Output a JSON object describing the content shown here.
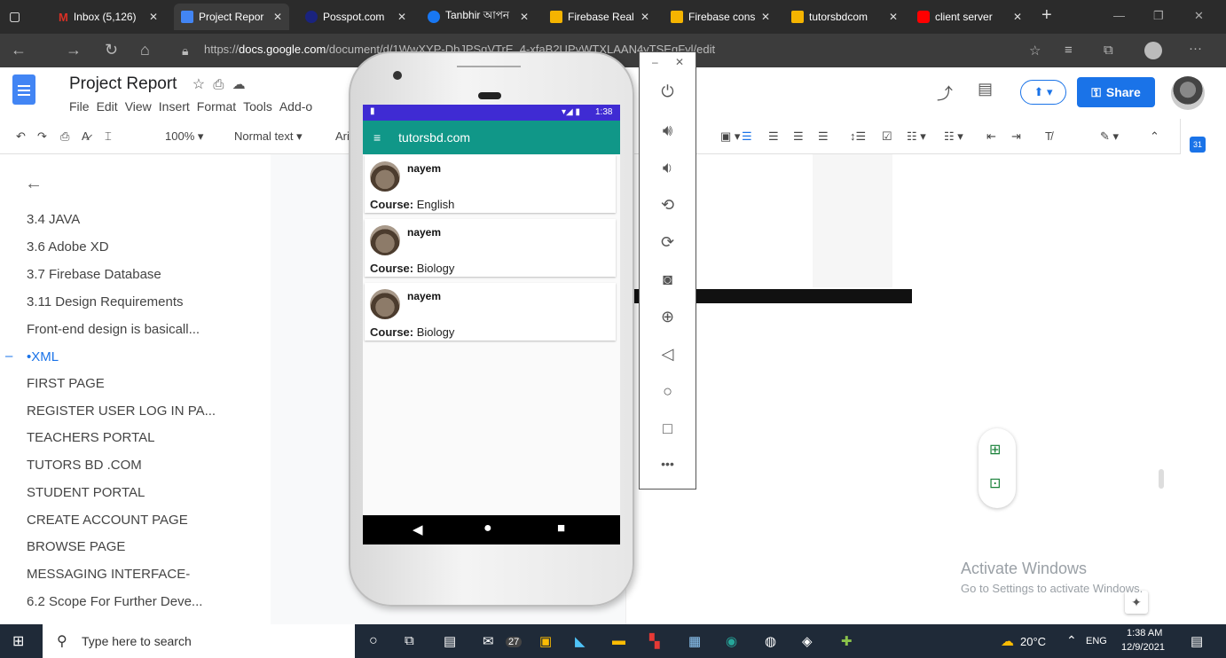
{
  "browser": {
    "tabs": [
      {
        "label": "Inbox (5,126)",
        "color": "#d93025"
      },
      {
        "label": "Project Repor",
        "color": "#4285f4"
      },
      {
        "label": "Posspot.com",
        "color": "#1a237e"
      },
      {
        "label": "Tanbhir আপন",
        "color": "#1877f2"
      },
      {
        "label": "Firebase Real",
        "color": "#f5b400"
      },
      {
        "label": "Firebase cons",
        "color": "#f5b400"
      },
      {
        "label": "tutorsbdcom",
        "color": "#f5b400"
      },
      {
        "label": "client server",
        "color": "#ff0000"
      }
    ],
    "url_prefix": "https://",
    "url_domain": "docs.google.com",
    "url_path": "/document/d/1WwXYP-DbJPSqVTrE_4-xfaB2UPyWTXLAAN4yTSEqFyl/edit"
  },
  "docs": {
    "title": "Project Report",
    "menu": [
      "File",
      "Edit",
      "View",
      "Insert",
      "Format",
      "Tools",
      "Add-o"
    ],
    "share_label": "Share",
    "zoom": "100%",
    "style": "Normal text",
    "font": "Ari"
  },
  "outline": {
    "items": [
      {
        "label": "3.4 JAVA"
      },
      {
        "label": "3.6 Adobe XD"
      },
      {
        "label": "3.7 Firebase Database"
      },
      {
        "label": "3.11 Design Requirements"
      },
      {
        "label": "Front-end design is basicall..."
      },
      {
        "label": "•XML"
      },
      {
        "label": "FIRST PAGE"
      },
      {
        "label": "REGISTER USER LOG IN PA..."
      },
      {
        "label": "TEACHERS PORTAL"
      },
      {
        "label": "TUTORS BD .COM"
      },
      {
        "label": "STUDENT PORTAL"
      },
      {
        "label": "CREATE ACCOUNT PAGE"
      },
      {
        "label": "BROWSE PAGE"
      },
      {
        "label": "MESSAGING INTERFACE-"
      },
      {
        "label": "6.2 Scope For Further Deve..."
      }
    ]
  },
  "watermark": {
    "line1": "Activate Windows",
    "line2": "Go to Settings to activate Windows."
  },
  "phone": {
    "time": "1:38",
    "app_title": "tutorsbd.com",
    "course_label": "Course:",
    "cards": [
      {
        "name": "nayem",
        "course": "English"
      },
      {
        "name": "nayem",
        "course": "Biology"
      },
      {
        "name": "nayem",
        "course": "Biology"
      }
    ]
  },
  "taskbar": {
    "search_placeholder": "Type here to search",
    "mail_badge": "27",
    "weather": "20°C",
    "lang": "ENG",
    "time": "1:38 AM",
    "date": "12/9/2021"
  }
}
